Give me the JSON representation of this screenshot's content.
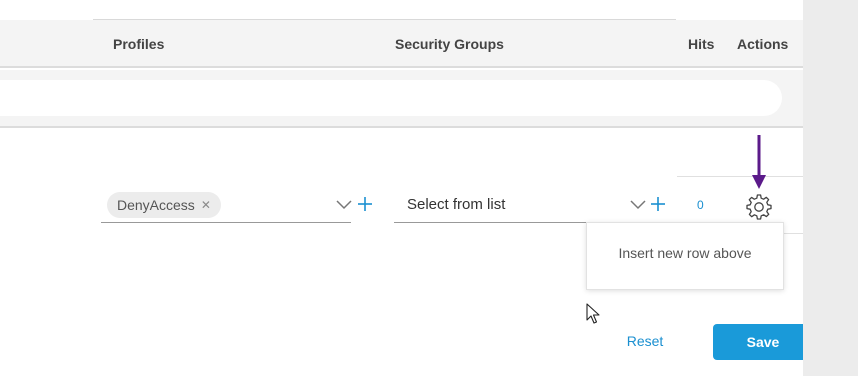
{
  "table": {
    "columns": {
      "profiles": "Profiles",
      "security_groups": "Security Groups",
      "hits": "Hits",
      "actions": "Actions"
    },
    "filter": {
      "value": ""
    },
    "row": {
      "profile_chip": "DenyAccess",
      "security_group_value": "Select from list",
      "hits": "0"
    }
  },
  "gear_menu": {
    "items": [
      "Insert new row above"
    ]
  },
  "footer": {
    "reset_label": "Reset",
    "save_label": "Save"
  },
  "colors": {
    "accent": "#1a9ad9",
    "link": "#1a8fd0",
    "annotation_arrow": "#5b1a8a"
  },
  "icons": [
    "remove-icon",
    "chevron-down-icon",
    "plus-icon",
    "gear-icon",
    "arrow-down-icon",
    "mouse-cursor-icon"
  ]
}
